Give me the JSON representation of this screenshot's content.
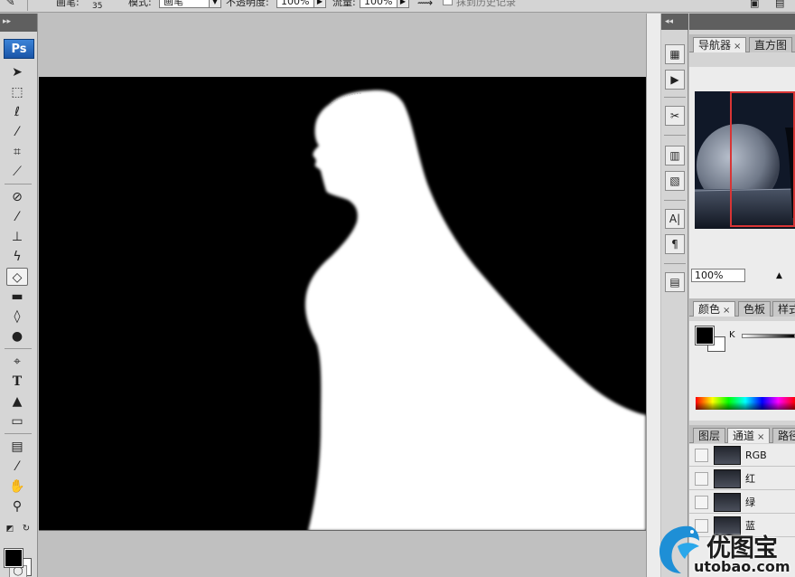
{
  "options_bar": {
    "brush_label": "画笔:",
    "brush_size": "35",
    "mode_label": "模式:",
    "mode_value": "画笔",
    "opacity_label": "不透明度:",
    "opacity_value": "100%",
    "flow_label": "流量:",
    "flow_value": "100%",
    "history_checkbox_label": "抹到历史记录"
  },
  "toolbox": {
    "logo": "Ps",
    "active_tool": "eraser-tool"
  },
  "navigator": {
    "tabs": [
      {
        "label": "导航器",
        "close": "×"
      },
      {
        "label": "直方图"
      }
    ],
    "zoom": "100%"
  },
  "color_panel": {
    "tabs": [
      {
        "label": "颜色",
        "close": "×"
      },
      {
        "label": "色板"
      },
      {
        "label": "样式"
      }
    ],
    "channel_label": "K",
    "foreground": "#000000",
    "background": "#ffffff"
  },
  "channels_panel": {
    "tabs": [
      {
        "label": "图层"
      },
      {
        "label": "通道",
        "close": "×"
      },
      {
        "label": "路径"
      }
    ],
    "channels": [
      {
        "name": "RGB"
      },
      {
        "name": "红"
      },
      {
        "name": "绿"
      },
      {
        "name": "蓝"
      }
    ]
  },
  "dock": {
    "type_icon_text": "A|",
    "paragraph_icon_text": "¶"
  },
  "watermark": {
    "brand": "优图宝",
    "url": "utobao.com"
  }
}
